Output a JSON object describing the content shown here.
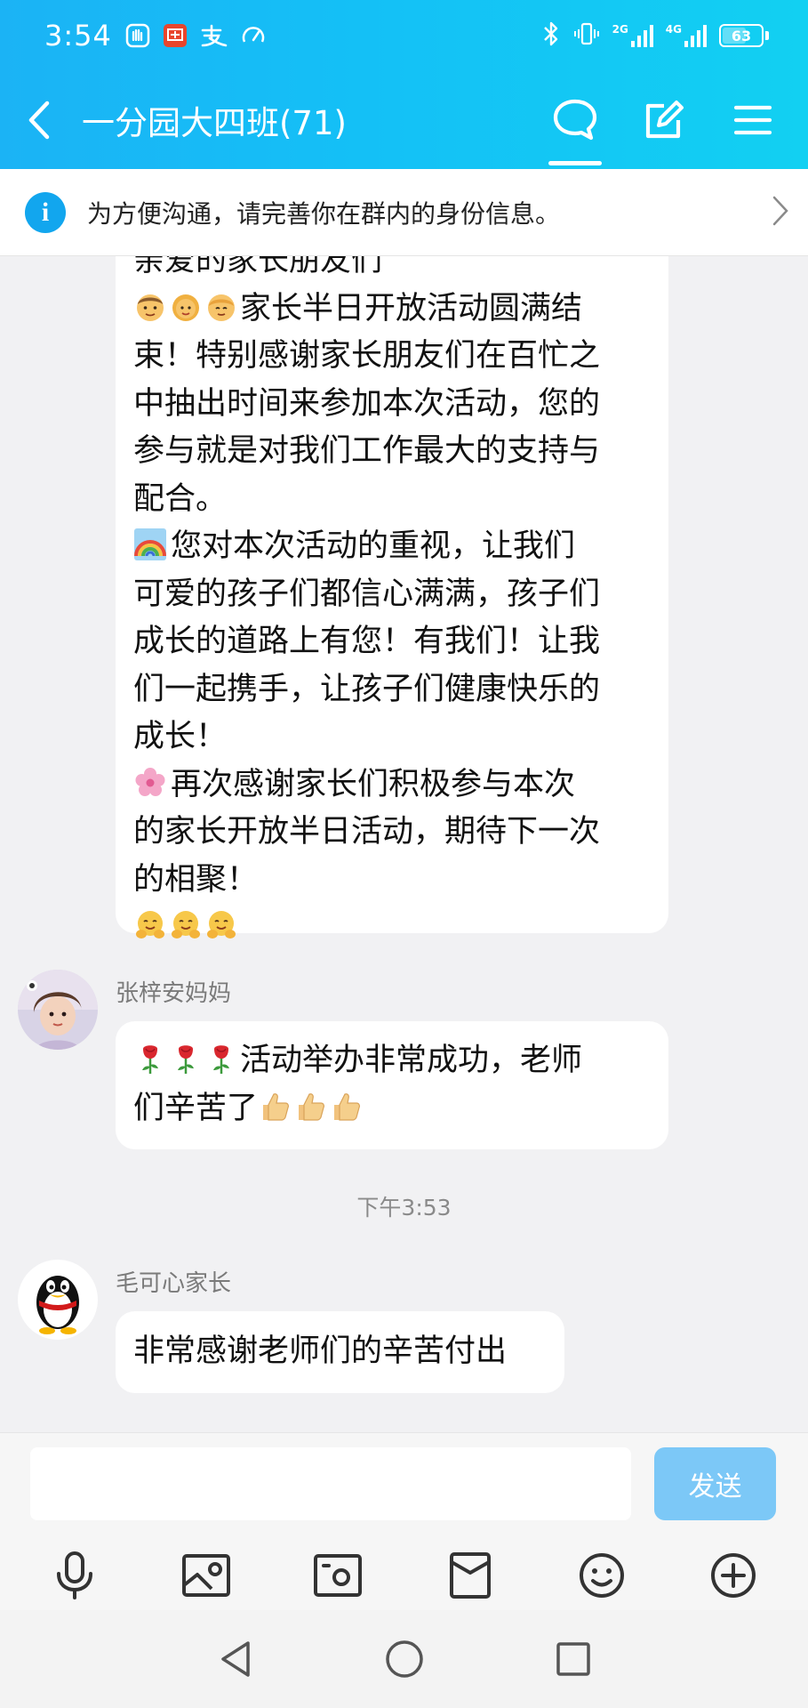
{
  "status_bar": {
    "time": "3:54",
    "left_icons": [
      "hand-icon",
      "taobao-app-icon",
      "alipay-icon",
      "speed-icon"
    ],
    "right_icons": [
      "bluetooth-icon",
      "vibrate-icon",
      "signal-2g-icon",
      "signal-4g-icon"
    ],
    "net_2g": "2G",
    "net_4g": "4G",
    "battery": "63",
    "battery_level": 0.63
  },
  "header": {
    "title": "一分园大四班(71)",
    "back_icon": "chevron-left-icon",
    "actions": [
      "chat-bubble-icon",
      "edit-icon",
      "menu-icon"
    ]
  },
  "banner": {
    "icon": "info-icon",
    "icon_glyph": "i",
    "text": "为方便沟通，请完善你在群内的身份信息。",
    "chevron": "chevron-right-icon"
  },
  "messages": [
    {
      "lines": [
        "亲爱的家长朋友们",
        "家长半日开放活动圆满结",
        "束！特别感谢家长朋友们在百忙之",
        "中抽出时间来参加本次活动，您的",
        "参与就是对我们工作最大的支持与",
        "配合。",
        "您对本次活动的重视，让我们",
        "可爱的孩子们都信心满满，孩子们",
        "成长的道路上有您！有我们！让我",
        "们一起携手，让孩子们健康快乐的",
        "成长！",
        "再次感谢家长们积极参与本次",
        "的家长开放半日活动，期待下一次",
        "的相聚！"
      ],
      "emojis": [
        "man-emoji",
        "woman-emoji",
        "child-emoji",
        "rainbow-emoji",
        "blossom-emoji",
        "hug-emoji"
      ]
    },
    {
      "sender": "张梓安妈妈",
      "lines": [
        "活动举办非常成功，老师",
        "们辛苦了"
      ],
      "emojis": [
        "rose-emoji",
        "thumbs-up-emoji"
      ]
    },
    {
      "sender": "毛可心家长",
      "lines": [
        "非常感谢老师们的辛苦付出"
      ]
    }
  ],
  "timestamp": "下午3:53",
  "input": {
    "placeholder": "",
    "send_label": "发送"
  },
  "toolbar": [
    "microphone-icon",
    "image-icon",
    "camera-icon",
    "red-packet-icon",
    "emoji-icon",
    "plus-circle-icon"
  ],
  "nav": [
    "back-triangle-icon",
    "home-circle-icon",
    "recents-square-icon"
  ],
  "colors": {
    "header_start": "#1bb3f5",
    "header_end": "#12d0f2",
    "send_button": "#7cc8f7",
    "info_icon": "#12a6ee",
    "chat_background": "#f1f1f3"
  }
}
